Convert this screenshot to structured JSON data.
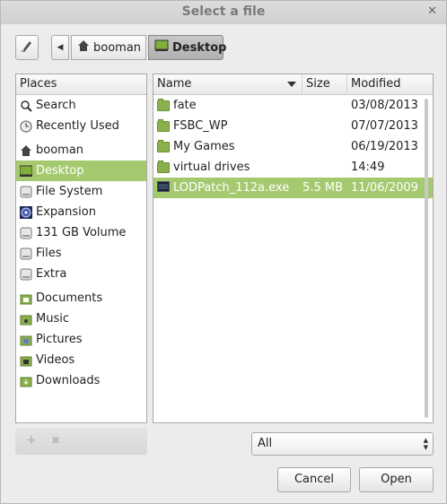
{
  "window": {
    "title": "Select a file",
    "close_glyph": "✕"
  },
  "pathbar": {
    "edit_icon": "pencil-icon",
    "back_glyph": "◀",
    "home_label": "booman",
    "current_label": "Desktop"
  },
  "places": {
    "header": "Places",
    "items": [
      {
        "label": "Search",
        "icon": "search-icon"
      },
      {
        "label": "Recently Used",
        "icon": "clock-icon"
      },
      {
        "label": "booman",
        "icon": "home-icon"
      },
      {
        "label": "Desktop",
        "icon": "desktop-icon",
        "selected": true
      },
      {
        "label": "File System",
        "icon": "drive-icon"
      },
      {
        "label": "Expansion",
        "icon": "disc-icon"
      },
      {
        "label": "131 GB Volume",
        "icon": "drive-icon"
      },
      {
        "label": "Files",
        "icon": "drive-icon"
      },
      {
        "label": "Extra",
        "icon": "drive-icon"
      },
      {
        "label": "Documents",
        "icon": "folder-icon"
      },
      {
        "label": "Music",
        "icon": "folder-icon"
      },
      {
        "label": "Pictures",
        "icon": "folder-icon"
      },
      {
        "label": "Videos",
        "icon": "folder-icon"
      },
      {
        "label": "Downloads",
        "icon": "folder-icon"
      }
    ],
    "add_glyph": "+",
    "remove_glyph": "✖"
  },
  "files": {
    "columns": {
      "name": "Name",
      "size": "Size",
      "modified": "Modified"
    },
    "rows": [
      {
        "name": "fate",
        "size": "",
        "modified": "03/08/2013",
        "icon": "folder-icon"
      },
      {
        "name": "FSBC_WP",
        "size": "",
        "modified": "07/07/2013",
        "icon": "folder-icon"
      },
      {
        "name": "My Games",
        "size": "",
        "modified": "06/19/2013",
        "icon": "folder-icon"
      },
      {
        "name": "virtual drives",
        "size": "",
        "modified": "14:49",
        "icon": "folder-icon"
      },
      {
        "name": "LODPatch_112a.exe",
        "size": "5.5 MB",
        "modified": "11/06/2009",
        "icon": "executable-icon",
        "selected": true
      }
    ]
  },
  "filter": {
    "value": "All",
    "spin_up": "▲",
    "spin_down": "▼"
  },
  "buttons": {
    "cancel": "Cancel",
    "open": "Open"
  }
}
